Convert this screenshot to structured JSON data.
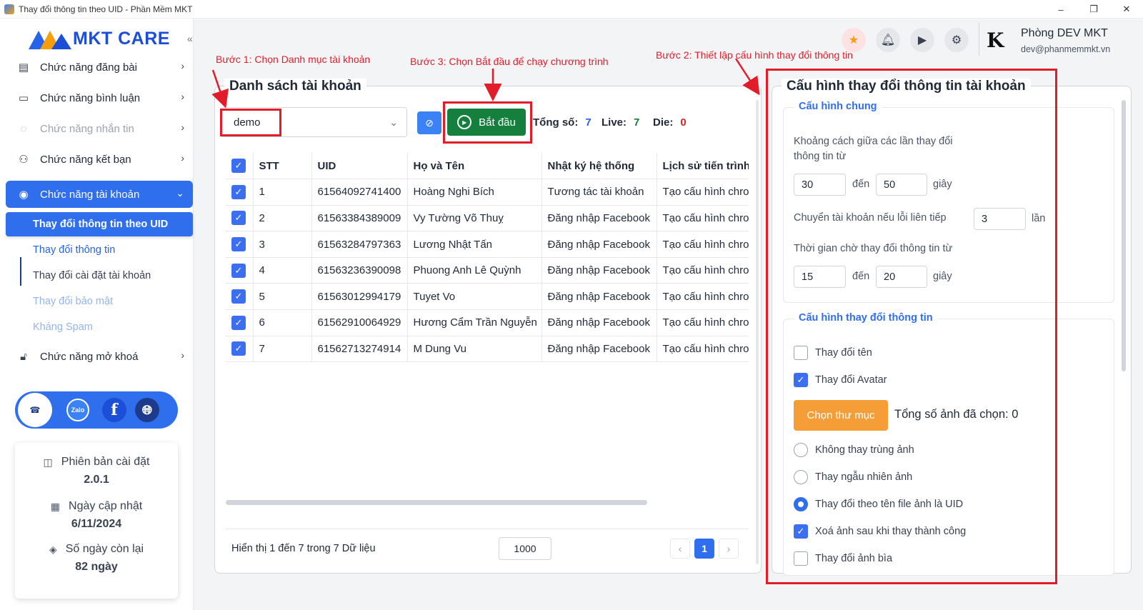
{
  "window": {
    "title": "Thay đổi thông tin theo UID - Phần Mềm MKT",
    "controls": [
      "–",
      "❐",
      "✕"
    ]
  },
  "logo": {
    "text": "MKT CARE"
  },
  "sidebar": {
    "collapse_icon": "«",
    "items": [
      {
        "label": "Chức năng đăng bài",
        "icon": "post-icon",
        "chevron": "›"
      },
      {
        "label": "Chức năng bình luận",
        "icon": "comment-icon",
        "chevron": "›"
      },
      {
        "label": "Chức năng nhắn tin",
        "icon": "chat-icon",
        "chevron": "›"
      },
      {
        "label": "Chức năng kết bạn",
        "icon": "add-friend-icon",
        "chevron": "›"
      },
      {
        "label": "Chức năng tài khoản",
        "icon": "account-icon",
        "chevron": "⌄"
      },
      {
        "label": "Chức năng mở khoá",
        "icon": "lock-icon",
        "chevron": "›"
      }
    ],
    "subitems": [
      "Thay đổi thông tin theo UID",
      "Thay đổi thông tin",
      "Thay đổi cài đặt tài khoản",
      "Thay đổi bảo mật",
      "Kháng Spam"
    ],
    "social": {
      "zalo": "Zalo",
      "facebook": "f"
    },
    "info": [
      {
        "label": "Phiên bản cài đặt",
        "value": "2.0.1",
        "icon": "version-icon"
      },
      {
        "label": "Ngày cập nhật",
        "value": "6/11/2024",
        "icon": "calendar-icon"
      },
      {
        "label": "Số ngày còn lại",
        "value": "82 ngày",
        "icon": "box-icon"
      }
    ]
  },
  "header": {
    "user_name": "Phòng DEV MKT",
    "user_email": "dev@phanmemmkt.vn",
    "avatar": "K"
  },
  "annotations": {
    "step1": "Bước 1: Chọn Danh mục tài khoản",
    "step2": "Bước 2: Thiết lập cấu hình thay đổi thông tin",
    "step3": "Bước 3: Chọn Bắt đầu để chạy chương trình"
  },
  "accounts": {
    "title": "Danh sách tài khoản",
    "category": "demo",
    "start_label": "Bắt đầu",
    "total_label": "Tổng số:",
    "total": "7",
    "live_label": "Live:",
    "live": "7",
    "die_label": "Die:",
    "die": "0",
    "columns": [
      "STT",
      "UID",
      "Họ và Tên",
      "Nhật ký hệ thống",
      "Lịch sử tiến trình"
    ],
    "rows": [
      [
        "1",
        "61564092741400",
        "Hoàng Nghi Bích",
        "Tương tác tài khoản",
        "Tạo cấu hình chrome"
      ],
      [
        "2",
        "61563384389009",
        "Vy Tường Võ Thuỵ",
        "Đăng nhập Facebook",
        "Tạo cấu hình chrome"
      ],
      [
        "3",
        "61563284797363",
        "Lương Nhật Tấn",
        "Đăng nhập Facebook",
        "Tạo cấu hình chrome"
      ],
      [
        "4",
        "61563236390098",
        "Phuong Anh Lê Quỳnh",
        "Đăng nhập Facebook",
        "Tạo cấu hình chrome"
      ],
      [
        "5",
        "61563012994179",
        "Tuyet Vo",
        "Đăng nhập Facebook",
        "Tạo cấu hình chrome"
      ],
      [
        "6",
        "61562910064929",
        "Hương Cẩm Trần Nguyễn",
        "Đăng nhập Facebook",
        "Tạo cấu hình chrome"
      ],
      [
        "7",
        "61562713274914",
        "M Dung Vu",
        "Đăng nhập Facebook",
        "Tạo cấu hình chrome"
      ]
    ],
    "showing": "Hiển thị 1 đến 7 trong 7 Dữ liệu",
    "page_size": "1000",
    "current_page": "1",
    "prev": "‹",
    "next": "›"
  },
  "config": {
    "title": "Cấu hình thay đổi thông tin tài khoản",
    "general": {
      "title": "Cấu hình chung",
      "delay_label": "Khoảng cách giữa các lần thay đổi thông tin từ",
      "delay_from": "30",
      "delay_to": "50",
      "to_label": "đến",
      "seconds_label": "giây",
      "switch_label": "Chuyển tài khoản nếu lỗi liên tiếp",
      "switch_value": "3",
      "times_label": "lần",
      "wait_label": "Thời gian chờ thay đổi thông tin từ",
      "wait_from": "15",
      "wait_to": "20"
    },
    "change": {
      "title": "Cấu hình thay đổi thông tin",
      "change_name": "Thay đổi tên",
      "change_avatar": "Thay đổi Avatar",
      "choose_folder": "Chọn thư mục",
      "total_images": "Tổng số ảnh đã chọn: 0",
      "no_duplicate": "Không thay trùng ảnh",
      "random": "Thay ngẫu nhiên ảnh",
      "by_uid": "Thay đổi theo tên file ảnh là UID",
      "delete_after": "Xoá ảnh sau khi thay thành công",
      "change_cover": "Thay đổi ảnh bìa"
    }
  },
  "colors": {
    "primary": "#2f6fed",
    "start": "#15803d",
    "orange": "#f59e38",
    "annotation": "#e11d2a",
    "live": "#15803d",
    "die": "#dc2626",
    "total": "#2563eb"
  }
}
